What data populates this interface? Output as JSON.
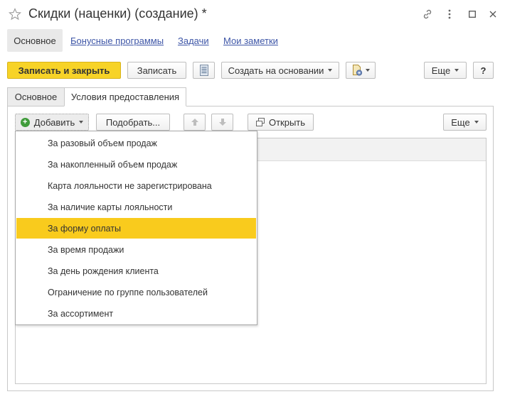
{
  "window": {
    "title": "Скидки (наценки) (создание) *"
  },
  "nav": {
    "items": [
      {
        "label": "Основное",
        "selected": true
      },
      {
        "label": "Бонусные программы"
      },
      {
        "label": "Задачи"
      },
      {
        "label": "Мои заметки"
      }
    ]
  },
  "toolbar": {
    "save_close_label": "Записать и закрыть",
    "save_label": "Записать",
    "create_based_label": "Создать на основании",
    "more_label": "Еще",
    "help_label": "?"
  },
  "tabs": [
    {
      "label": "Основное",
      "active": false
    },
    {
      "label": "Условия предоставления",
      "active": true
    }
  ],
  "table_toolbar": {
    "add_label": "Добавить",
    "pick_label": "Подобрать...",
    "open_label": "Открыть",
    "more_label": "Еще"
  },
  "add_menu": {
    "items": [
      {
        "label": "За разовый объем продаж"
      },
      {
        "label": "За накопленный объем продаж"
      },
      {
        "label": "Карта лояльности не зарегистрирована"
      },
      {
        "label": "За наличие карты лояльности"
      },
      {
        "label": "За форму оплаты",
        "highlighted": true
      },
      {
        "label": "За время продажи"
      },
      {
        "label": "За день рождения клиента"
      },
      {
        "label": "Ограничение по группе пользователей"
      },
      {
        "label": "За ассортимент"
      }
    ]
  },
  "colors": {
    "accent": "#f7d327",
    "highlight": "#f9cb1d",
    "link": "#3e56a7"
  }
}
